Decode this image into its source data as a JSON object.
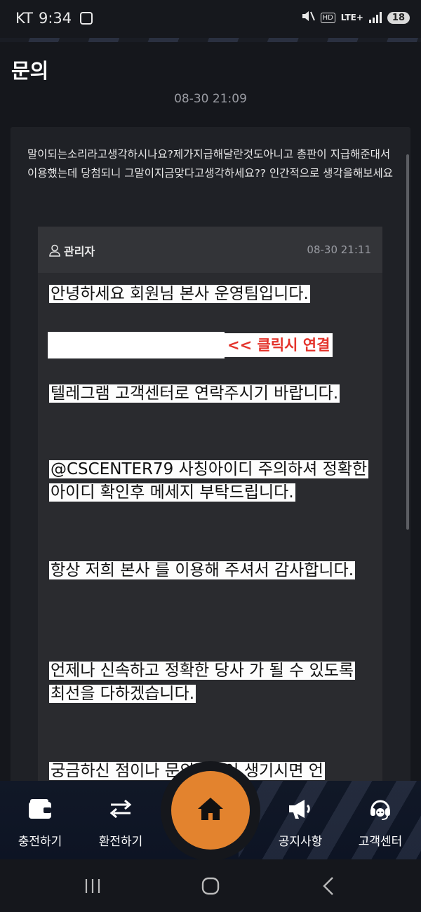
{
  "status": {
    "carrier": "KT",
    "time": "9:34",
    "hd": "HD",
    "lte": "LTE+",
    "battery": "18"
  },
  "header": {
    "title": "문의"
  },
  "inquiry": {
    "time": "08-30 21:09",
    "question": "말이되는소리라고생각하시나요?제가지급해달란것도아니고 총판이 지급해준대서 이용했는데 당첨되니 그말이지금맞다고생각하세요?? 인간적으로 생각을해보세요"
  },
  "reply": {
    "author": "관리자",
    "time": "08-30 21:11",
    "line1": "안녕하세요 회원님 본사 운영팀입니다.",
    "link_label": "<< 클릭시 연결",
    "line2": "텔레그램 고객센터로 연락주시기 바랍니다.",
    "line3": "@CSCENTER79   사칭아이디 주의하셔 정확한 아이디 확인후 메세지 부탁드립니다.",
    "line4": " 항상 저희 본사 를 이용해 주셔서 감사합니다.",
    "line5": "언제나 신속하고 정확한 당사 가 될 수 있도록 최선을 다하겠습니다.",
    "line6": "궁금하신 점이나 문의사항이 생기시면 언"
  },
  "nav": {
    "charge": "충전하기",
    "exchange": "환전하기",
    "home_icon": "home-icon",
    "notice": "공지사항",
    "support": "고객센터"
  },
  "colors": {
    "accent": "#e3832e",
    "link_red": "#e4332b",
    "background": "#15171c"
  }
}
